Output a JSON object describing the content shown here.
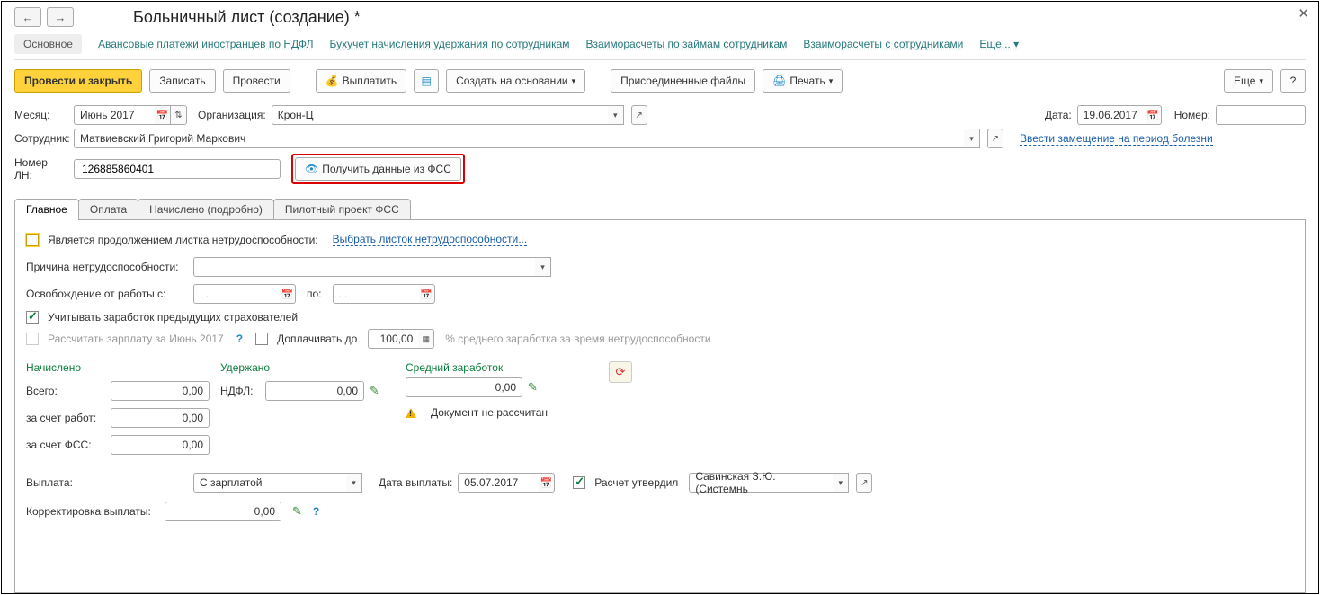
{
  "title": "Больничный лист (создание) *",
  "navTabs": {
    "main": "Основное",
    "advances": "Авансовые платежи иностранцев по НДФЛ",
    "accounting": "Бухучет начисления удержания по сотрудникам",
    "loans": "Взаиморасчеты по займам сотрудникам",
    "settlements": "Взаиморасчеты с сотрудниками",
    "more": "Еще..."
  },
  "toolbar": {
    "postClose": "Провести и закрыть",
    "write": "Записать",
    "post": "Провести",
    "pay": "Выплатить",
    "createBased": "Создать на основании",
    "attached": "Присоединенные файлы",
    "print": "Печать",
    "more": "Еще",
    "help": "?"
  },
  "header": {
    "monthLabel": "Месяц:",
    "monthValue": "Июнь 2017",
    "orgLabel": "Организация:",
    "orgValue": "Крон-Ц",
    "dateLabel": "Дата:",
    "dateValue": "19.06.2017",
    "numberLabel": "Номер:",
    "numberValue": "",
    "empLabel": "Сотрудник:",
    "empValue": "Матвиевский Григорий Маркович",
    "substLink": "Ввести замещение на период болезни",
    "lnLabel": "Номер ЛН:",
    "lnValue": "126885860401",
    "getFss": "Получить данные из ФСС"
  },
  "subTabs": {
    "main": "Главное",
    "payment": "Оплата",
    "accrued": "Начислено (подробно)",
    "pilot": "Пилотный проект ФСС"
  },
  "panel": {
    "contLabel": "Является продолжением листка нетрудоспособности:",
    "selectSheet": "Выбрать листок нетрудоспособности...",
    "reasonLabel": "Причина нетрудоспособности:",
    "releaseLabel": "Освобождение от работы с:",
    "toLabel": "по:",
    "datePlaceholder": "  .  .    ",
    "consider": "Учитывать заработок предыдущих страхователей",
    "calcSalary": "Рассчитать зарплату за Июнь 2017",
    "payExtra": "Доплачивать до",
    "payExtraValue": "100,00",
    "avgNote": "% среднего заработка за время нетрудоспособности",
    "accruedHead": "Начислено",
    "withheldHead": "Удержано",
    "avgHead": "Средний заработок",
    "totalLabel": "Всего:",
    "ndfLabel": "НДФЛ:",
    "employerLabel": "за счет работ:",
    "fssLabel": "за счет ФСС:",
    "zero": "0,00",
    "notCalc": "Документ не рассчитан",
    "payoutLabel": "Выплата:",
    "payoutValue": "С зарплатой",
    "payoutDateLabel": "Дата выплаты:",
    "payoutDateValue": "05.07.2017",
    "approvedLabel": "Расчет утвердил",
    "approvedValue": "Савинская З.Ю. (Системнь",
    "corrLabel": "Корректировка выплаты:"
  }
}
